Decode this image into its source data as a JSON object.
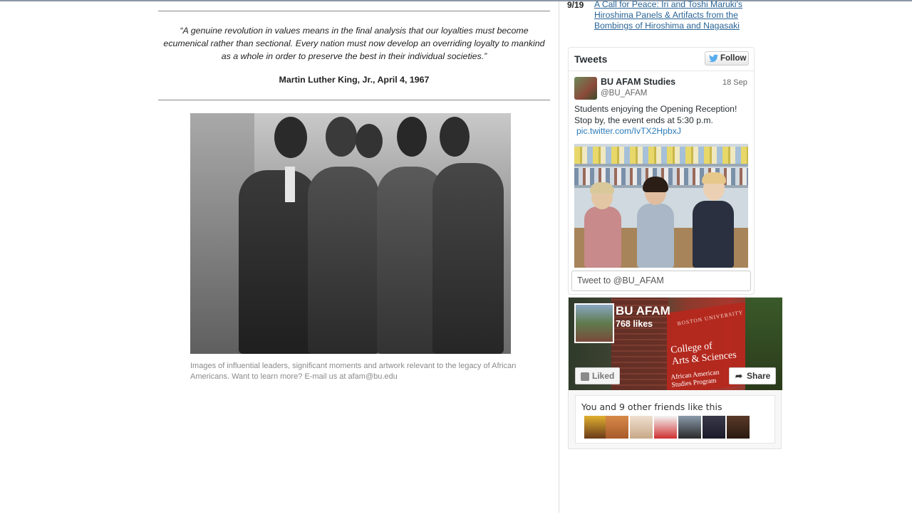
{
  "quote": {
    "text": "“A genuine revolution in values means in the final analysis that our loyalties must become ecumenical rather than sectional. Every nation must now develop an overriding loyalty to mankind as a whole in order to preserve the best in their individual societies.”",
    "attribution": "Martin Luther King, Jr., April 4, 1967"
  },
  "feature": {
    "caption": "Images of influential leaders, significant moments and artwork relevant to the legacy of African Americans. Want to learn more? E-mail us at afam@bu.edu"
  },
  "news": {
    "date": "9/19",
    "link": "A Call for Peace: Iri and Toshi Maruki's Hiroshima Panels & Artifacts from the Bombings of Hiroshima and Nagasaki"
  },
  "twitter": {
    "title": "Tweets",
    "follow_label": "Follow",
    "tweet": {
      "name": "BU AFAM Studies",
      "handle": "@BU_AFAM",
      "date": "18 Sep",
      "text": "Students enjoying the Opening Reception! Stop by, the event ends at 5:30 p.m.",
      "pic_link": "pic.twitter.com/IvTX2HpbxJ"
    },
    "compose_placeholder": "Tweet to @BU_AFAM",
    "icons": [
      "twitter-bird-icon"
    ],
    "colors": {
      "link": "#2b7bb9",
      "text": "#292f33"
    }
  },
  "facebook": {
    "page_name": "BU AFAM",
    "likes": "768 likes",
    "liked_label": "Liked",
    "share_label": "Share",
    "friends_text": "You and 9 other friends like this",
    "sign": {
      "top": "BOSTON UNIVERSITY",
      "line1": "College of",
      "line2": "Arts & Sciences",
      "line3": "African American",
      "line4": "Studies Program"
    },
    "icons": [
      "facebook-like-icon",
      "share-arrow-icon"
    ],
    "colors": {
      "sign_red": "#b5281e"
    }
  }
}
